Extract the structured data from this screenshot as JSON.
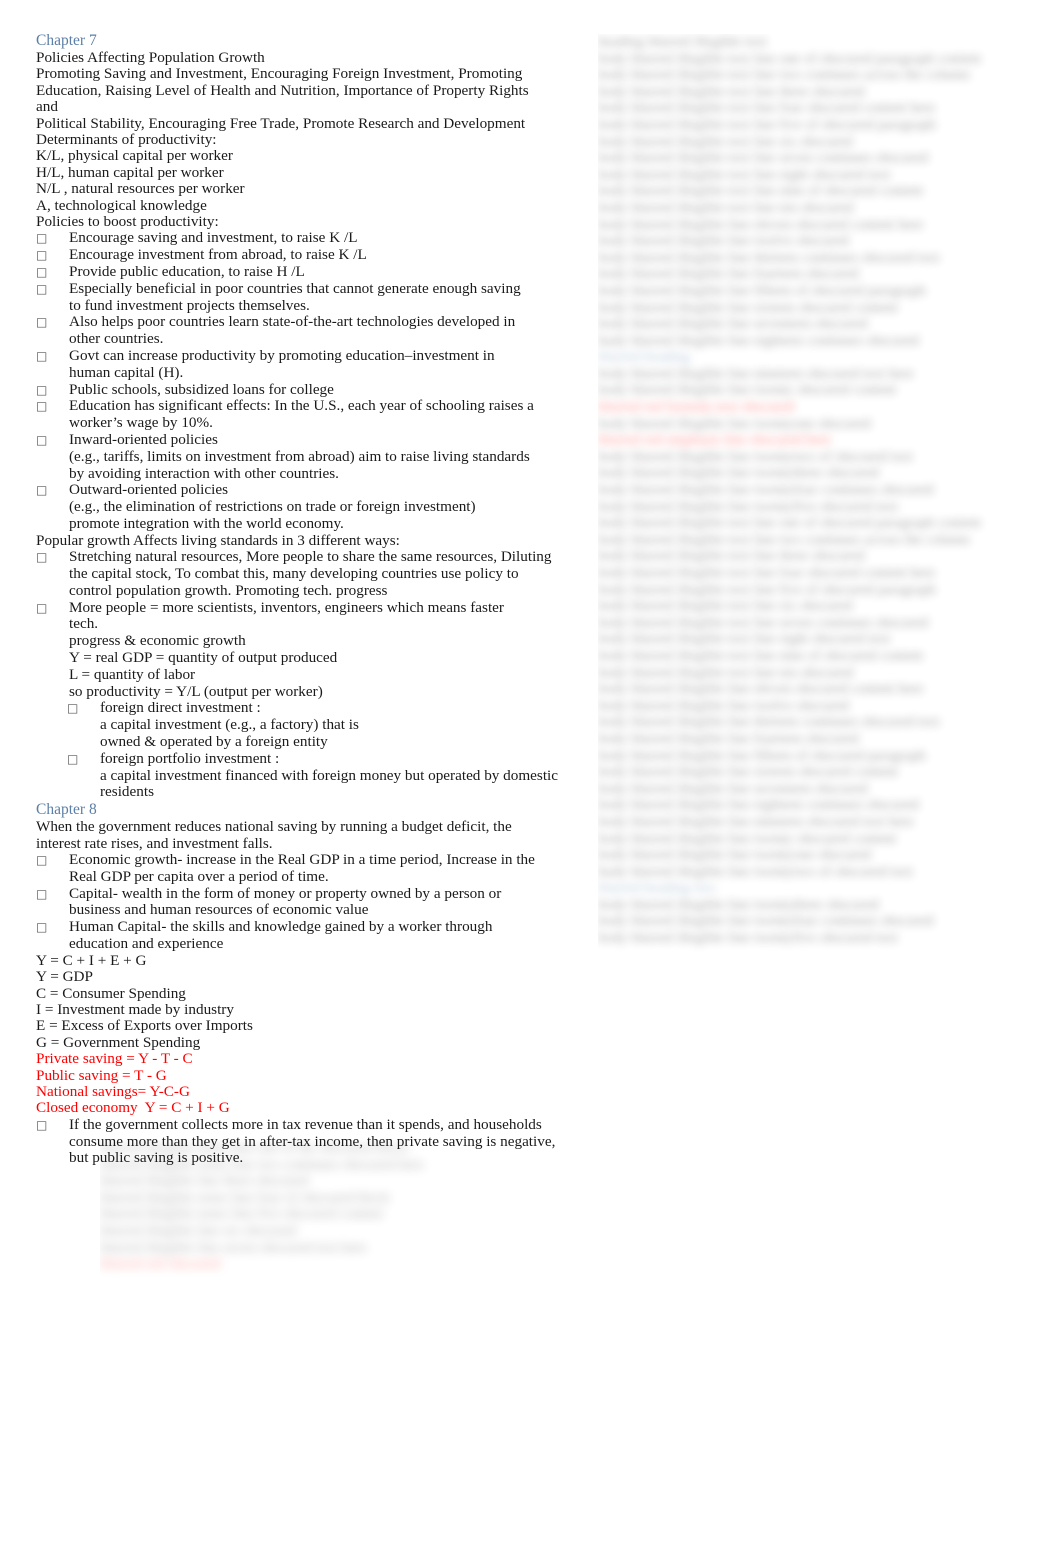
{
  "document": {
    "kind": "study-notes",
    "bullet_glyph": "□",
    "colors": {
      "heading_blue": "#5b7fa6",
      "emphasis_red": "#ff0000",
      "body_text": "#1a1a1a",
      "page_background": "#ffffff"
    }
  },
  "left_column": {
    "chapter7": {
      "heading": "Chapter 7",
      "intro_lines": [
        "Policies Affecting Population Growth",
        "Promoting Saving and Investment, Encouraging Foreign Investment, Promoting",
        "Education, Raising Level of Health and Nutrition, Importance of Property Rights and",
        "Political Stability, Encouraging Free Trade, Promote Research and Development",
        "Determinants of productivity:",
        "K/L, physical capital per worker",
        "H/L, human capital per worker",
        "N/L , natural resources per worker",
        "A, technological knowledge",
        "Policies to boost productivity:"
      ],
      "policy_bullets": [
        "Encourage saving and investment, to raise K /L",
        "Encourage investment from abroad, to raise K /L",
        "Provide public education, to raise H /L",
        "Especially beneficial in poor countries that cannot generate enough saving to fund investment projects themselves.",
        "Also helps poor countries learn state-of-the-art technologies developed in other countries.",
        "Govt can increase productivity by promoting education–investment in human capital (H).",
        "Public schools, subsidized loans for college",
        "Education has significant effects:  In the U.S., each year of schooling raises a worker’s wage by 10%."
      ],
      "inward_label": "Inward-oriented policies",
      "inward_detail": "(e.g., tariffs, limits on investment from abroad) aim to raise living standards by avoiding interaction with other countries.",
      "outward_label": "Outward-oriented policies",
      "outward_detail_line1": "(e.g., the elimination of restrictions on trade or foreign investment)",
      "outward_detail_line2": "promote integration with the world economy.",
      "popular_growth_heading": "Popular growth Affects living standards in 3 different ways:",
      "growth_bullet_1": "Stretching natural resources, More people to share the same resources, Diluting the capital stock, To combat this, many developing countries use policy to control population growth. Promoting tech. progress",
      "growth_bullet_2": "More people =  more scientists, inventors, engineers which means faster tech.",
      "growth_bullet_2_cont": "progress & economic growth",
      "definitions": [
        "Y = real GDP = quantity of output produced",
        "L = quantity of labor",
        "so productivity = Y/L  (output per worker)"
      ],
      "fdi_label": "foreign direct investment   :",
      "fdi_detail_line1": "a capital investment (e.g., a factory) that is",
      "fdi_detail_line2": "owned & operated by a foreign entity",
      "fpi_label": "foreign portfolio investment  :",
      "fpi_detail": "a capital investment financed with foreign money but operated by domestic residents"
    },
    "chapter8": {
      "heading": "Chapter 8",
      "intro_line1": "When the government reduces national saving by running a budget deficit, the",
      "intro_line2": "interest rate rises, and investment falls.",
      "term_bullets": [
        "Economic growth- increase in the Real GDP in a time period, Increase in the Real GDP per capita over a period of time.",
        "Capital- wealth in the form of money or property owned by a person or business and human resources of economic value",
        "Human Capital- the skills and knowledge gained by a worker through education and experience"
      ],
      "identity_lines": [
        "Y = C + I + E + G",
        "Y = GDP",
        "C = Consumer Spending",
        "I = Investment made by industry",
        "E = Excess of Exports over Imports",
        "G = Government Spending"
      ],
      "red_formula_lines": [
        "Private saving = Y - T - C",
        "Public saving = T - G",
        "National savings= Y-C-G",
        "Closed economy  Y = C + I + G"
      ],
      "closing_bullet": "If the government collects more in tax revenue than it spends, and households consume more than they get in after-tax income, then private saving is negative, but public saving is positive."
    }
  },
  "redacted": {
    "note": "blurred-illegible",
    "right_column_placeholder": [
      "heading blurred illegible text",
      "body blurred illegible text line one of obscured paragraph content",
      "body blurred illegible text line two continues across the column",
      "body blurred illegible text line three obscured",
      "body blurred illegible text line four obscured content here",
      "body blurred illegible text line five of obscured paragraph",
      "body blurred illegible text line six obscured",
      "body blurred illegible text line seven continues obscured",
      "body blurred illegible text line eight obscured text",
      "body blurred illegible text line nine of obscured content",
      "body blurred illegible text line ten obscured",
      "body blurred illegible line eleven obscured content here",
      "body blurred illegible line twelve obscured",
      "body blurred illegible line thirteen continues obscured text",
      "body blurred illegible line fourteen obscured",
      "body blurred illegible line fifteen of obscured paragraph",
      "body blurred illegible line sixteen obscured content",
      "body blurred illegible line seventeen obscured",
      "body blurred illegible line eighteen continues obscured",
      "body blurred illegible line nineteen obscured text here",
      "body blurred illegible line twenty obscured content",
      "body blurred illegible line twentyone obscured",
      "body blurred illegible line twentytwo of obscured text",
      "body blurred illegible line twentythree obscured",
      "body blurred illegible line twentyfour continues obscured",
      "body blurred illegible line twentyfive obscured text"
    ],
    "right_column_heading_1": "blurred heading",
    "right_column_red_1": "blurred red formula text obscured",
    "right_column_red_2": "blurred red emphasis line obscured here",
    "right_column_heading_2": "blurred heading two",
    "bottom_left_placeholder": [
      "blurred illegible notes line one of the obscured block",
      "blurred illegible notes line two continues obscured here",
      "blurred illegible line three obscured",
      "blurred illegible notes line four of obscured block",
      "blurred illegible notes line five obscured content",
      "blurred illegible line six obscured",
      "blurred illegible line seven obscured text here"
    ],
    "bottom_left_red": "blurred red obscured"
  }
}
